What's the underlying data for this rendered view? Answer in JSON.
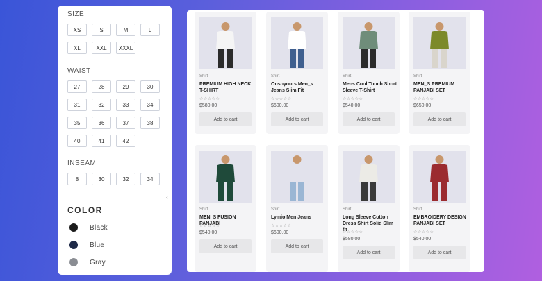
{
  "filters": {
    "size": {
      "title": "SIZE",
      "options": [
        "XS",
        "S",
        "M",
        "L",
        "XL",
        "XXL",
        "XXXL"
      ]
    },
    "waist": {
      "title": "WAIST",
      "options": [
        "27",
        "28",
        "29",
        "30",
        "31",
        "32",
        "33",
        "34",
        "35",
        "36",
        "37",
        "38",
        "40",
        "41",
        "42"
      ]
    },
    "inseam": {
      "title": "INSEAM",
      "options": [
        "8",
        "30",
        "32",
        "34"
      ]
    },
    "color": {
      "title": "COLOR",
      "options": [
        {
          "label": "Black",
          "color": "#1b1b1b"
        },
        {
          "label": "Blue",
          "color": "#1f2a48"
        },
        {
          "label": "Gray",
          "color": "#8a8d93"
        }
      ]
    }
  },
  "products": [
    {
      "category": "Shirt",
      "title": "PREMIUM HIGH NECK T-SHIRT",
      "rating": "☆☆☆☆☆",
      "price": "$580.00",
      "button": "Add to cart",
      "icon": "person-white-tshirt-icon",
      "top_color": "#f5f5f5",
      "bottom_color": "#2b2b2b"
    },
    {
      "category": "Shirt",
      "title": "Onsoyours Men_s Jeans Slim Fit",
      "rating": "☆☆☆☆☆",
      "price": "$600.00",
      "button": "Add to cart",
      "icon": "person-jeans-icon",
      "top_color": "#ffffff",
      "bottom_color": "#3f5f8f"
    },
    {
      "category": "Shirt",
      "title": "Mens Cool Touch Short Sleeve T-Shirt",
      "rating": "☆☆☆☆☆",
      "price": "$540.00",
      "button": "Add to cart",
      "icon": "person-green-tshirt-icon",
      "top_color": "#6f8d7a",
      "bottom_color": "#2b2b2b"
    },
    {
      "category": "Shirt",
      "title": "MEN_S PREMIUM PANJABI SET",
      "rating": "☆☆☆☆☆",
      "price": "$650.00",
      "button": "Add to cart",
      "icon": "person-olive-panjabi-icon",
      "top_color": "#7c8a2a",
      "bottom_color": "#d9d5cc"
    },
    {
      "category": "Shirt",
      "title": "MEN_S FUSION PANJABI",
      "rating": "☆☆☆☆☆",
      "price": "$540.00",
      "button": "Add to cart",
      "icon": "person-green-panjabi-icon",
      "top_color": "#1f4a3a",
      "bottom_color": "#1f4a3a"
    },
    {
      "category": "Shirt",
      "title": "Lymio Men Jeans",
      "rating": "☆☆☆☆☆",
      "price": "$600.00",
      "button": "Add to cart",
      "icon": "person-light-jeans-icon",
      "top_color": "#e2e2ec",
      "bottom_color": "#9ab6d4"
    },
    {
      "category": "Shirt",
      "title": "Long Sleeve Cotton Dress Shirt Solid Slim fit",
      "rating": "☆☆☆☆☆",
      "price": "$580.00",
      "button": "Add to cart",
      "icon": "person-white-shirt-icon",
      "top_color": "#ecebe6",
      "bottom_color": "#3a3a3a"
    },
    {
      "category": "Shirt",
      "title": "EMBROIDERY DESIGN PANJABI SET",
      "rating": "☆☆☆☆☆",
      "price": "$540.00",
      "button": "Add to cart",
      "icon": "person-red-panjabi-icon",
      "top_color": "#9b2b2f",
      "bottom_color": "#9b2b2f"
    }
  ]
}
